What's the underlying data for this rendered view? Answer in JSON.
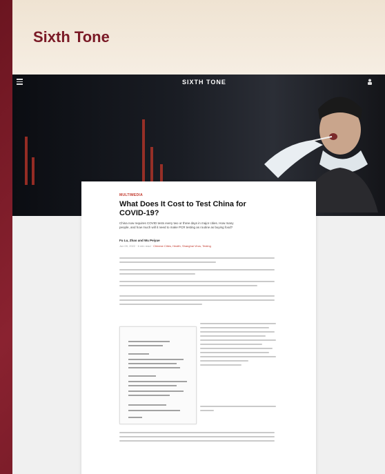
{
  "brand": {
    "title": "Sixth Tone"
  },
  "site": {
    "logo": "SIXTH TONE"
  },
  "article": {
    "kicker": "MULTIMEDIA",
    "headline": "What Does It Cost to Test China for COVID-19?",
    "dek": "China now requires COVID tests every two or three days in major cities. How many people, and how much will it need to make PCR testing as routine as buying food?",
    "byline": "Fu Lu, Zhao and Wu Peiyue",
    "meta": "Jun 09, 2022 · 6 min read · ",
    "meta_tag": "Chinese Cities, Health, Shanghai Virus, Testing"
  },
  "colors": {
    "accent": "#c2372a",
    "brand": "#7a1a26"
  },
  "icons": {
    "menu": "menu-icon",
    "user": "user-icon"
  }
}
